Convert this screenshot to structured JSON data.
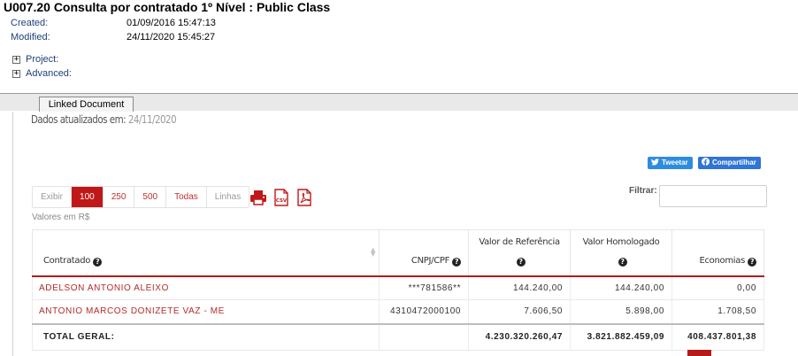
{
  "header": {
    "title": "U007.20 Consulta por contratado 1º Nível : Public Class",
    "created_label": "Created:",
    "created_value": "01/09/2016 15:47:13",
    "modified_label": "Modified:",
    "modified_value": "24/11/2020 15:45:27",
    "project_label": "Project:",
    "advanced_label": "Advanced:"
  },
  "tabs": {
    "linked_document": "Linked Document"
  },
  "report": {
    "updated_prefix": "Dados atualizados em:",
    "updated_date": "24/11/2020",
    "tweet_label": "Tweetar",
    "share_label": "Compartilhar",
    "length_options": [
      "Exibir",
      "100",
      "250",
      "500",
      "Todas",
      "Linhas"
    ],
    "length_active": "100",
    "export_icons": [
      "print-icon",
      "csv-icon",
      "pdf-icon"
    ],
    "filter_label": "Filtrar:",
    "filter_value": "",
    "currency_note": "Valores em R$",
    "accent_color": "#c01818"
  },
  "table": {
    "columns": [
      {
        "line1": "",
        "line2": "Contratado"
      },
      {
        "line1": "",
        "line2": "CNPJ/CPF"
      },
      {
        "line1": "Valor de Referência",
        "line2": ""
      },
      {
        "line1": "Valor Homologado",
        "line2": ""
      },
      {
        "line1": "",
        "line2": "Economias"
      }
    ],
    "rows": [
      {
        "contratado": "ADELSON ANTONIO ALEIXO",
        "cnpj": "***781586**",
        "referencia": "144.240,00",
        "homologado": "144.240,00",
        "economias": "0,00"
      },
      {
        "contratado": "ANTONIO MARCOS DONIZETE VAZ - ME",
        "cnpj": "4310472000100",
        "referencia": "7.606,50",
        "homologado": "5.898,00",
        "economias": "1.708,50"
      }
    ],
    "total": {
      "label": "TOTAL GERAL:",
      "referencia": "4.230.320.260,47",
      "homologado": "3.821.882.459,09",
      "economias": "408.437.801,38"
    }
  }
}
